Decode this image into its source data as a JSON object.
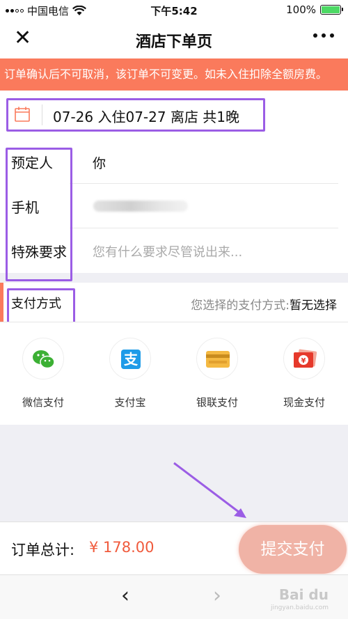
{
  "status_bar": {
    "carrier": "中国电信",
    "time": "下午5:42",
    "battery_percent": "100%",
    "battery_level": 1.0
  },
  "nav": {
    "title": "酒店下单页",
    "close_icon": "close-icon",
    "more_icon": "more-icon"
  },
  "notice": "订单确认后不可取消，该订单不可变更。如未入住扣除全额房费。",
  "stay": {
    "dates_text": "07-26 入住07-27 离店   共1晚"
  },
  "form": {
    "booker_label": "预定人",
    "booker_value": "你",
    "phone_label": "手机",
    "requests_label": "特殊要求",
    "requests_placeholder": "您有什么要求尽管说出来..."
  },
  "payment": {
    "label": "支付方式",
    "selected_prefix": "您选择的支付方式:",
    "selected_value": "暂无选择",
    "methods": [
      {
        "name": "微信支付",
        "icon": "wechat-pay-icon"
      },
      {
        "name": "支付宝",
        "icon": "alipay-icon"
      },
      {
        "name": "银联支付",
        "icon": "unionpay-card-icon"
      },
      {
        "name": "现金支付",
        "icon": "cash-icon"
      }
    ]
  },
  "footer": {
    "total_label": "订单总计:",
    "total_amount": "¥ 178.00",
    "submit_label": "提交支付"
  },
  "colors": {
    "accent": "#fa7a5c",
    "annotation": "#9b5de5",
    "price": "#f05a3c",
    "submit_bg": "#f0b3a6"
  }
}
